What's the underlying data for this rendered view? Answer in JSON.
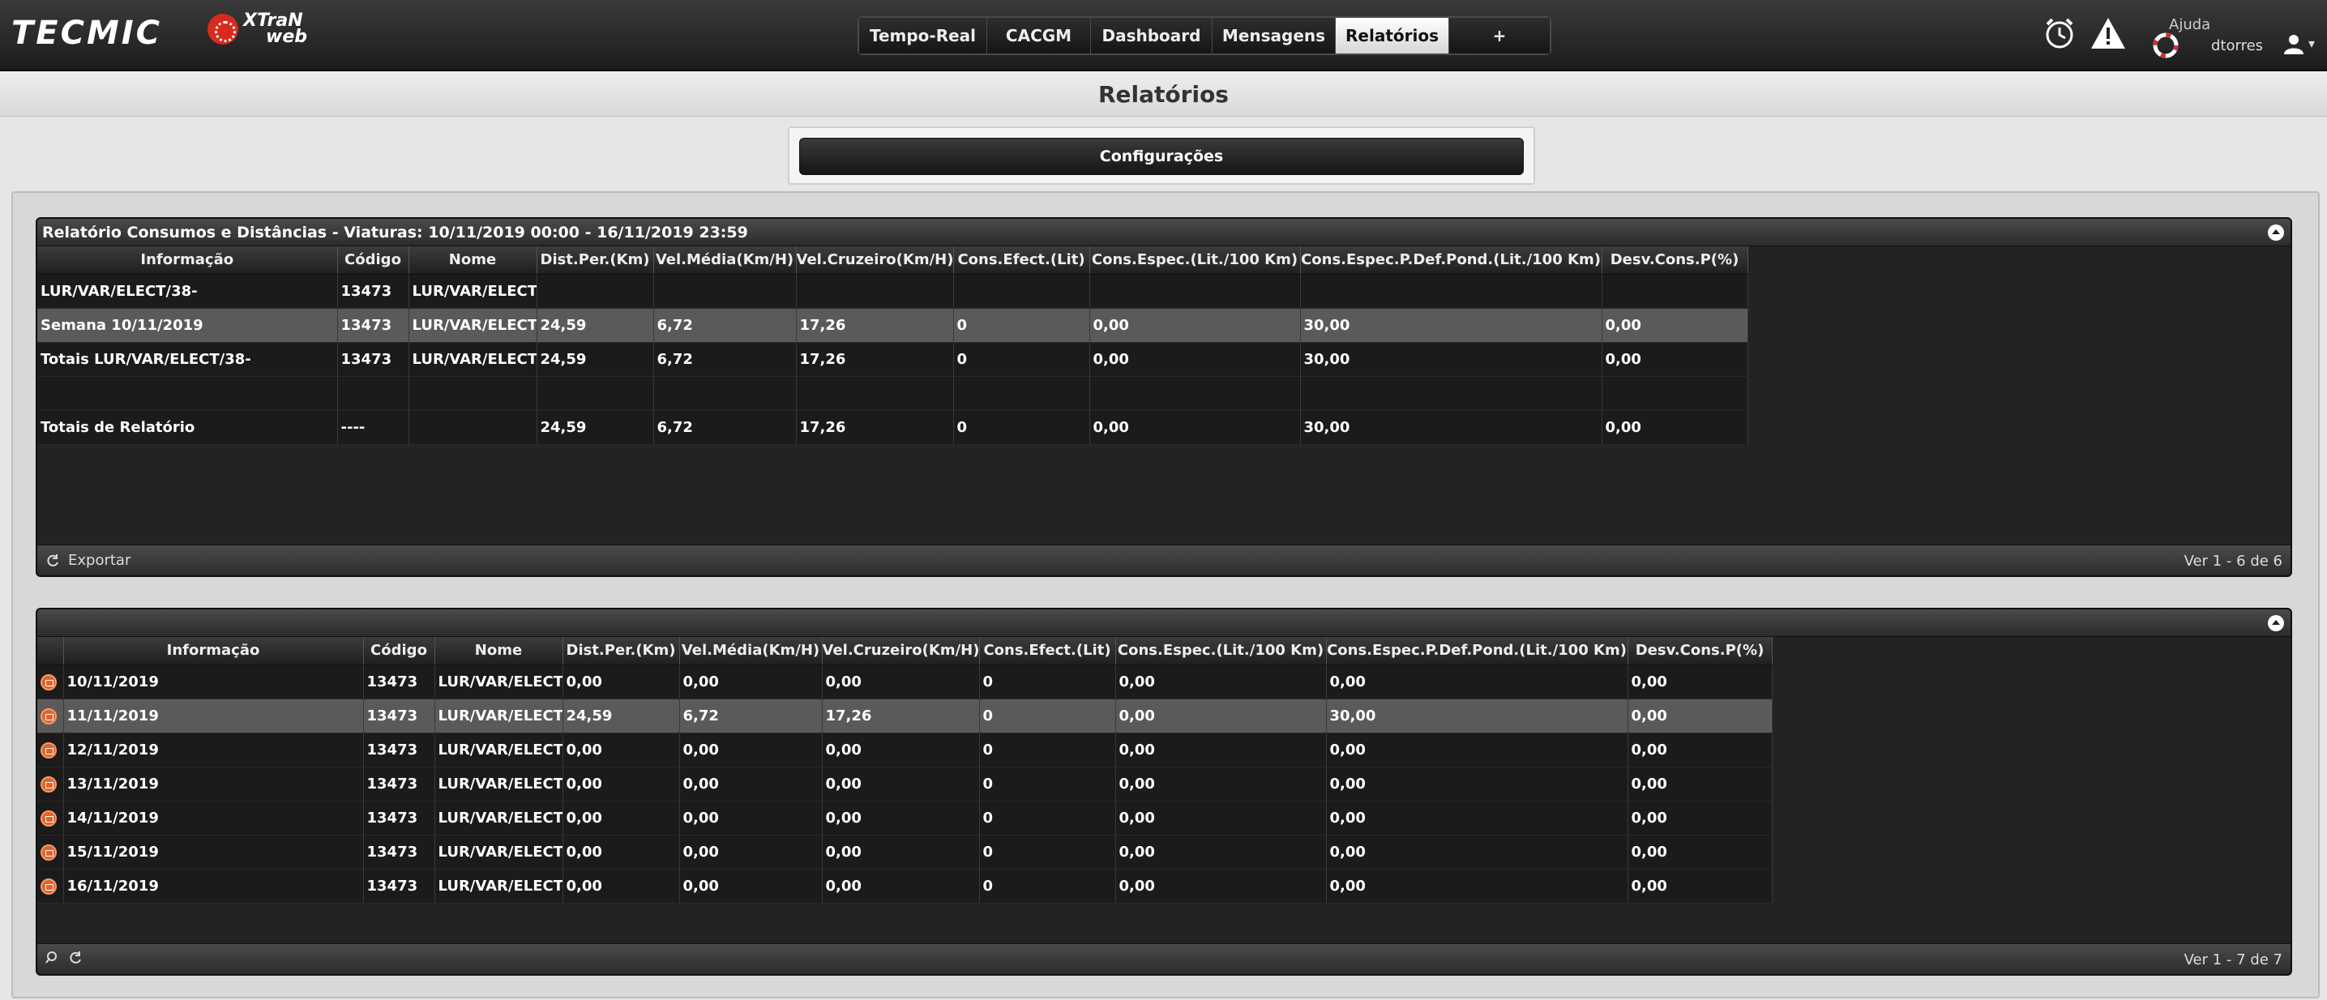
{
  "brand": {
    "logo_text": "TECMIC",
    "product_line1": "XTraN",
    "product_line2": "web"
  },
  "nav": {
    "tabs": [
      {
        "label": "Tempo-Real"
      },
      {
        "label": "CACGM"
      },
      {
        "label": "Dashboard"
      },
      {
        "label": "Mensagens"
      },
      {
        "label": "Relatórios",
        "active": true
      },
      {
        "label": "+"
      }
    ]
  },
  "header": {
    "help_label": "Ajuda",
    "username": "dtorres",
    "icons": [
      "alarm-clock-icon",
      "warning-icon",
      "lifebuoy-icon",
      "user-icon"
    ]
  },
  "page": {
    "title": "Relatórios",
    "config_button": "Configurações"
  },
  "report1": {
    "title": "Relatório Consumos e Distâncias - Viaturas: 10/11/2019 00:00 - 16/11/2019 23:59",
    "columns": [
      "Informação",
      "Código",
      "Nome",
      "Dist.Per.(Km)",
      "Vel.Média(Km/H)",
      "Vel.Cruzeiro(Km/H)",
      "Cons.Efect.(Lit)",
      "Cons.Espec.(Lit./100 Km)",
      "Cons.Espec.P.Def.Pond.(Lit./100 Km)",
      "Desv.Cons.P(%)"
    ],
    "rows": [
      [
        "LUR/VAR/ELECT/38-",
        "13473",
        "LUR/VAR/ELECT/",
        "",
        "",
        "",
        "",
        "",
        "",
        ""
      ],
      [
        "Semana 10/11/2019",
        "13473",
        "LUR/VAR/ELECT/",
        "24,59",
        "6,72",
        "17,26",
        "0",
        "0,00",
        "30,00",
        "0,00"
      ],
      [
        "Totais LUR/VAR/ELECT/38-",
        "13473",
        "LUR/VAR/ELECT/",
        "24,59",
        "6,72",
        "17,26",
        "0",
        "0,00",
        "30,00",
        "0,00"
      ],
      [
        "",
        "",
        "",
        "",
        "",
        "",
        "",
        "",
        "",
        ""
      ],
      [
        "Totais de Relatório",
        "----",
        "",
        "24,59",
        "6,72",
        "17,26",
        "0",
        "0,00",
        "30,00",
        "0,00"
      ]
    ],
    "footer": {
      "export_label": "Exportar",
      "pager": "Ver 1 - 6 de 6"
    }
  },
  "report2": {
    "columns": [
      "",
      "Informação",
      "Código",
      "Nome",
      "Dist.Per.(Km)",
      "Vel.Média(Km/H)",
      "Vel.Cruzeiro(Km/H)",
      "Cons.Efect.(Lit)",
      "Cons.Espec.(Lit./100 Km)",
      "Cons.Espec.P.Def.Pond.(Lit./100 Km)",
      "Desv.Cons.P(%)"
    ],
    "rows": [
      [
        "10/11/2019",
        "13473",
        "LUR/VAR/ELECT/",
        "0,00",
        "0,00",
        "0,00",
        "0",
        "0,00",
        "0,00",
        "0,00"
      ],
      [
        "11/11/2019",
        "13473",
        "LUR/VAR/ELECT/",
        "24,59",
        "6,72",
        "17,26",
        "0",
        "0,00",
        "30,00",
        "0,00"
      ],
      [
        "12/11/2019",
        "13473",
        "LUR/VAR/ELECT/",
        "0,00",
        "0,00",
        "0,00",
        "0",
        "0,00",
        "0,00",
        "0,00"
      ],
      [
        "13/11/2019",
        "13473",
        "LUR/VAR/ELECT/",
        "0,00",
        "0,00",
        "0,00",
        "0",
        "0,00",
        "0,00",
        "0,00"
      ],
      [
        "14/11/2019",
        "13473",
        "LUR/VAR/ELECT/",
        "0,00",
        "0,00",
        "0,00",
        "0",
        "0,00",
        "0,00",
        "0,00"
      ],
      [
        "15/11/2019",
        "13473",
        "LUR/VAR/ELECT/",
        "0,00",
        "0,00",
        "0,00",
        "0",
        "0,00",
        "0,00",
        "0,00"
      ],
      [
        "16/11/2019",
        "13473",
        "LUR/VAR/ELECT/",
        "0,00",
        "0,00",
        "0,00",
        "0",
        "0,00",
        "0,00",
        "0,00"
      ]
    ],
    "footer": {
      "pager": "Ver 1 - 7 de 7"
    }
  }
}
